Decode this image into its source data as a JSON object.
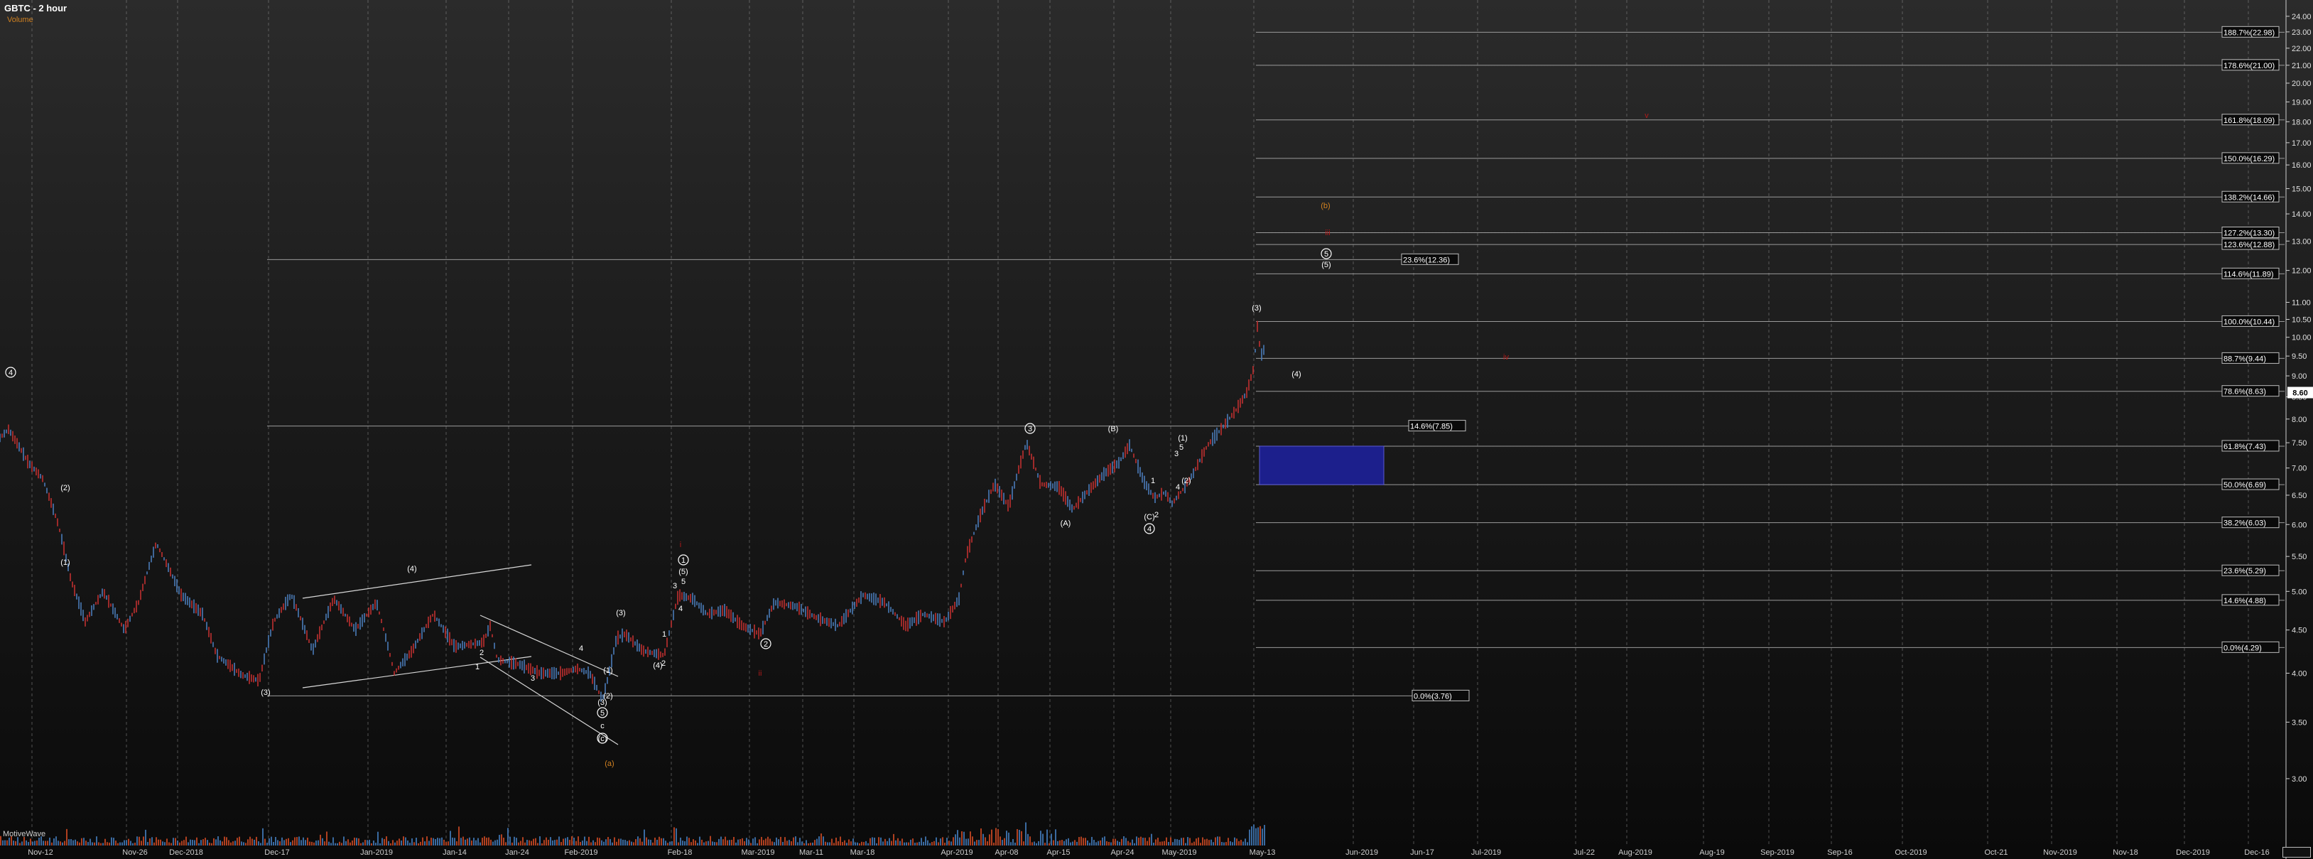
{
  "header": {
    "title": "GBTC - 2 hour",
    "subtitle": "Volume"
  },
  "footer": {
    "provider": "MotiveWave"
  },
  "chart_data": {
    "type": "candlestick",
    "symbol": "GBTC",
    "interval": "2 hour",
    "ylim": [
      2.5,
      24.8
    ],
    "y_scale": "log",
    "y_ticks": [
      3.0,
      3.5,
      4.0,
      4.5,
      5.0,
      5.5,
      6.0,
      6.5,
      7.0,
      7.5,
      8.0,
      8.5,
      9.0,
      9.5,
      10.0,
      10.5,
      11.0,
      12.0,
      13.0,
      14.0,
      15.0,
      16.0,
      17.0,
      18.0,
      19.0,
      20.0,
      21.0,
      22.0,
      23.0,
      24.0
    ],
    "price_label": "8.60",
    "x_ticks": [
      "Nov-12",
      "Nov-26",
      "Dec-2018",
      "Dec-17",
      "Jan-2019",
      "Jan-14",
      "Jan-24",
      "Feb-2019",
      "Feb-18",
      "Mar-2019",
      "Mar-11",
      "Mar-18",
      "Apr-2019",
      "Apr-08",
      "Apr-15",
      "Apr-24",
      "May-2019",
      "May-13",
      "Jun-2019",
      "Jun-17",
      "Jul-2019",
      "Jul-22",
      "Aug-2019",
      "Aug-19",
      "Sep-2019",
      "Sep-16",
      "Oct-2019",
      "Oct-21",
      "Nov-2019",
      "Nov-18",
      "Dec-2019",
      "Dec-16"
    ],
    "price_path": [
      [
        0,
        7.6
      ],
      [
        12,
        7.78
      ],
      [
        40,
        7.1
      ],
      [
        60,
        6.8
      ],
      [
        82,
        6.0
      ],
      [
        100,
        5.15
      ],
      [
        120,
        4.6
      ],
      [
        145,
        5.0
      ],
      [
        175,
        4.5
      ],
      [
        195,
        4.85
      ],
      [
        220,
        5.7
      ],
      [
        255,
        4.95
      ],
      [
        285,
        4.7
      ],
      [
        305,
        4.2
      ],
      [
        340,
        3.98
      ],
      [
        365,
        3.92
      ],
      [
        385,
        4.6
      ],
      [
        410,
        4.95
      ],
      [
        440,
        4.25
      ],
      [
        470,
        4.9
      ],
      [
        500,
        4.5
      ],
      [
        530,
        4.85
      ],
      [
        555,
        4.0
      ],
      [
        580,
        4.25
      ],
      [
        610,
        4.7
      ],
      [
        640,
        4.3
      ],
      [
        680,
        4.35
      ],
      [
        690,
        4.55
      ],
      [
        700,
        4.15
      ],
      [
        730,
        4.1
      ],
      [
        760,
        4.0
      ],
      [
        790,
        4.0
      ],
      [
        812,
        4.05
      ],
      [
        830,
        4.0
      ],
      [
        848,
        3.72
      ],
      [
        856,
        3.95
      ],
      [
        868,
        4.4
      ],
      [
        880,
        4.45
      ],
      [
        905,
        4.25
      ],
      [
        935,
        4.2
      ],
      [
        955,
        4.95
      ],
      [
        975,
        4.9
      ],
      [
        995,
        4.7
      ],
      [
        1020,
        4.75
      ],
      [
        1045,
        4.55
      ],
      [
        1070,
        4.45
      ],
      [
        1090,
        4.85
      ],
      [
        1120,
        4.8
      ],
      [
        1150,
        4.65
      ],
      [
        1180,
        4.55
      ],
      [
        1215,
        4.95
      ],
      [
        1245,
        4.85
      ],
      [
        1275,
        4.55
      ],
      [
        1300,
        4.7
      ],
      [
        1330,
        4.6
      ],
      [
        1350,
        4.9
      ],
      [
        1360,
        5.5
      ],
      [
        1380,
        6.15
      ],
      [
        1400,
        6.7
      ],
      [
        1420,
        6.3
      ],
      [
        1445,
        7.5
      ],
      [
        1465,
        6.7
      ],
      [
        1490,
        6.65
      ],
      [
        1510,
        6.25
      ],
      [
        1530,
        6.55
      ],
      [
        1555,
        6.9
      ],
      [
        1575,
        7.1
      ],
      [
        1590,
        7.45
      ],
      [
        1610,
        6.75
      ],
      [
        1625,
        6.45
      ],
      [
        1640,
        6.55
      ],
      [
        1650,
        6.35
      ],
      [
        1665,
        6.6
      ],
      [
        1680,
        6.9
      ],
      [
        1700,
        7.45
      ],
      [
        1720,
        7.8
      ],
      [
        1740,
        8.2
      ],
      [
        1755,
        8.6
      ],
      [
        1765,
        9.2
      ],
      [
        1770,
        10.3
      ],
      [
        1775,
        9.5
      ],
      [
        1780,
        9.7
      ]
    ],
    "fib_levels": [
      {
        "label": "188.7%(22.98)",
        "value": 22.98
      },
      {
        "label": "178.6%(21.00)",
        "value": 21.0
      },
      {
        "label": "161.8%(18.09)",
        "value": 18.09
      },
      {
        "label": "150.0%(16.29)",
        "value": 16.29
      },
      {
        "label": "138.2%(14.66)",
        "value": 14.66
      },
      {
        "label": "127.2%(13.30)",
        "value": 13.3
      },
      {
        "label": "123.6%(12.88)",
        "value": 12.88
      },
      {
        "label": "114.6%(11.89)",
        "value": 11.89
      },
      {
        "label": "100.0%(10.44)",
        "value": 10.44
      },
      {
        "label": "88.7%(9.44)",
        "value": 9.44
      },
      {
        "label": "78.6%(8.63)",
        "value": 8.63
      },
      {
        "label": "61.8%(7.43)",
        "value": 7.43
      },
      {
        "label": "50.0%(6.69)",
        "value": 6.69
      },
      {
        "label": "38.2%(6.03)",
        "value": 6.03
      },
      {
        "label": "23.6%(5.29)",
        "value": 5.29
      },
      {
        "label": "14.6%(4.88)",
        "value": 4.88
      },
      {
        "label": "0.0%(4.29)",
        "value": 4.29
      }
    ],
    "long_levels": [
      {
        "label": "23.6%(12.36)",
        "value": 12.36
      },
      {
        "label": "14.6%(7.85)",
        "value": 7.85
      },
      {
        "label": "0.0%(3.76)",
        "value": 3.76
      }
    ],
    "target_box": {
      "from": 6.69,
      "to": 7.43,
      "color": "#1c1f8c"
    },
    "wave_labels": [
      {
        "text": "4",
        "circled": true,
        "color": "#ffffff",
        "value": 7.85
      },
      {
        "text": "(2)",
        "color": "#ffffff",
        "value": 6.6
      },
      {
        "text": "(1)",
        "color": "#ffffff",
        "value": 5.6
      },
      {
        "text": "(3)",
        "color": "#ffffff",
        "value": 3.8
      },
      {
        "text": "(4)",
        "color": "#ffffff",
        "value": 5.35
      },
      {
        "text": "2",
        "color": "#ffffff",
        "value": 4.72
      },
      {
        "text": "1",
        "color": "#ffffff",
        "value": 4.22
      },
      {
        "text": "3",
        "color": "#ffffff",
        "value": 4.08
      },
      {
        "text": "4",
        "color": "#ffffff",
        "value": 4.37
      },
      {
        "text": "(1)",
        "color": "#ffffff",
        "value": 4.1
      },
      {
        "text": "(2)",
        "color": "#ffffff",
        "value": 3.8
      },
      {
        "text": "(3)",
        "color": "#ffffff",
        "value": 3.72
      },
      {
        "text": "5",
        "circled": true,
        "color": "#ffffff",
        "value": 3.62
      },
      {
        "text": "c",
        "color": "#ffffff",
        "value": 3.45
      },
      {
        "text": "(c)",
        "circled": true,
        "color": "#ffffff",
        "value": 3.32
      },
      {
        "text": "(a)",
        "color": "#d08020",
        "value": 2.92
      },
      {
        "text": "(3)",
        "color": "#ffffff",
        "value": 4.6
      },
      {
        "text": "1",
        "color": "#ffffff",
        "value": 4.45
      },
      {
        "text": "2",
        "color": "#ffffff",
        "value": 4.22
      },
      {
        "text": "(4)",
        "color": "#ffffff",
        "value": 4.2
      },
      {
        "text": "3",
        "color": "#ffffff",
        "value": 4.9
      },
      {
        "text": "4",
        "color": "#ffffff",
        "value": 4.66
      },
      {
        "text": "5",
        "color": "#ffffff",
        "value": 4.95
      },
      {
        "text": "(5)",
        "color": "#ffffff",
        "value": 5.1
      },
      {
        "text": "1",
        "circled": true,
        "color": "#ffffff",
        "value": 5.27
      },
      {
        "text": "i",
        "color": "#b01a1a",
        "value": 5.55
      },
      {
        "text": "2",
        "circled": true,
        "color": "#ffffff",
        "value": 4.33
      },
      {
        "text": "ii",
        "color": "#b01a1a",
        "value": 4.1
      },
      {
        "text": "3",
        "circled": true,
        "color": "#ffffff",
        "value": 7.85
      },
      {
        "text": "(A)",
        "color": "#ffffff",
        "value": 6.2
      },
      {
        "text": "(B)",
        "color": "#ffffff",
        "value": 7.85
      },
      {
        "text": "(C)",
        "color": "#ffffff",
        "value": 6.25
      },
      {
        "text": "2",
        "color": "#ffffff",
        "value": 6.3
      },
      {
        "text": "4",
        "circled": true,
        "color": "#ffffff",
        "value": 6.05
      },
      {
        "text": "1",
        "color": "#ffffff",
        "value": 6.65
      },
      {
        "text": "4",
        "color": "#ffffff",
        "value": 6.65
      },
      {
        "text": "(2)",
        "color": "#ffffff",
        "value": 6.7
      },
      {
        "text": "3",
        "color": "#ffffff",
        "value": 7.25
      },
      {
        "text": "5",
        "color": "#ffffff",
        "value": 7.5
      },
      {
        "text": "(1)",
        "color": "#ffffff",
        "value": 7.7
      },
      {
        "text": "(3)",
        "color": "#ffffff",
        "value": 10.7
      },
      {
        "text": "(4)",
        "color": "#ffffff",
        "value": 9.0
      },
      {
        "text": "5",
        "circled": true,
        "color": "#ffffff",
        "value": 12.3
      },
      {
        "text": "(5)",
        "color": "#ffffff",
        "value": 11.95
      },
      {
        "text": "iii",
        "color": "#b01a1a",
        "value": 13.15
      },
      {
        "text": "(b)",
        "color": "#d08020",
        "value": 14.0
      },
      {
        "text": "iv",
        "color": "#b01a1a",
        "value": 9.45
      },
      {
        "text": "v",
        "color": "#b01a1a",
        "value": 18.15
      }
    ]
  },
  "colors": {
    "grid": "#8a8a8a",
    "up_bar": "#4a7bb8",
    "down_bar": "#c03030",
    "fib_line": "#9a9a9a",
    "text": "#ffffff"
  }
}
